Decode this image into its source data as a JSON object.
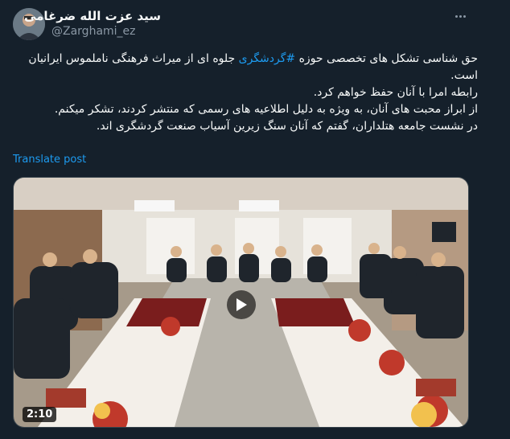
{
  "author": {
    "name": "سید عزت الله ضرغامی",
    "handle": "@Zarghami_ez"
  },
  "tweet": {
    "line1_pre": "حق شناسی تشکل های تخصصی حوزه",
    "hashtag": "#گردشگری",
    "line1_post": "جلوه ای از میراث فرهنگی ناملموس ایرانیان است.",
    "line2": "رابطه امرا با آنان حفظ خواهم کرد.",
    "line3": "از ابراز محبت های آنان، به ویژه به دلیل اطلاعیه های رسمی که منتشر کردند، تشکر میکنم.",
    "line4": "در نشست جامعه هتلداران، گفتم که آنان سنگ زیرین آسیاب صنعت گردشگری اند."
  },
  "translate_label": "Translate post",
  "video": {
    "duration": "2:10"
  },
  "icons": {
    "more": "more-icon",
    "play": "play-icon"
  },
  "colors": {
    "background": "#15202b",
    "accent": "#1d9bf0",
    "muted": "#8b98a5"
  }
}
